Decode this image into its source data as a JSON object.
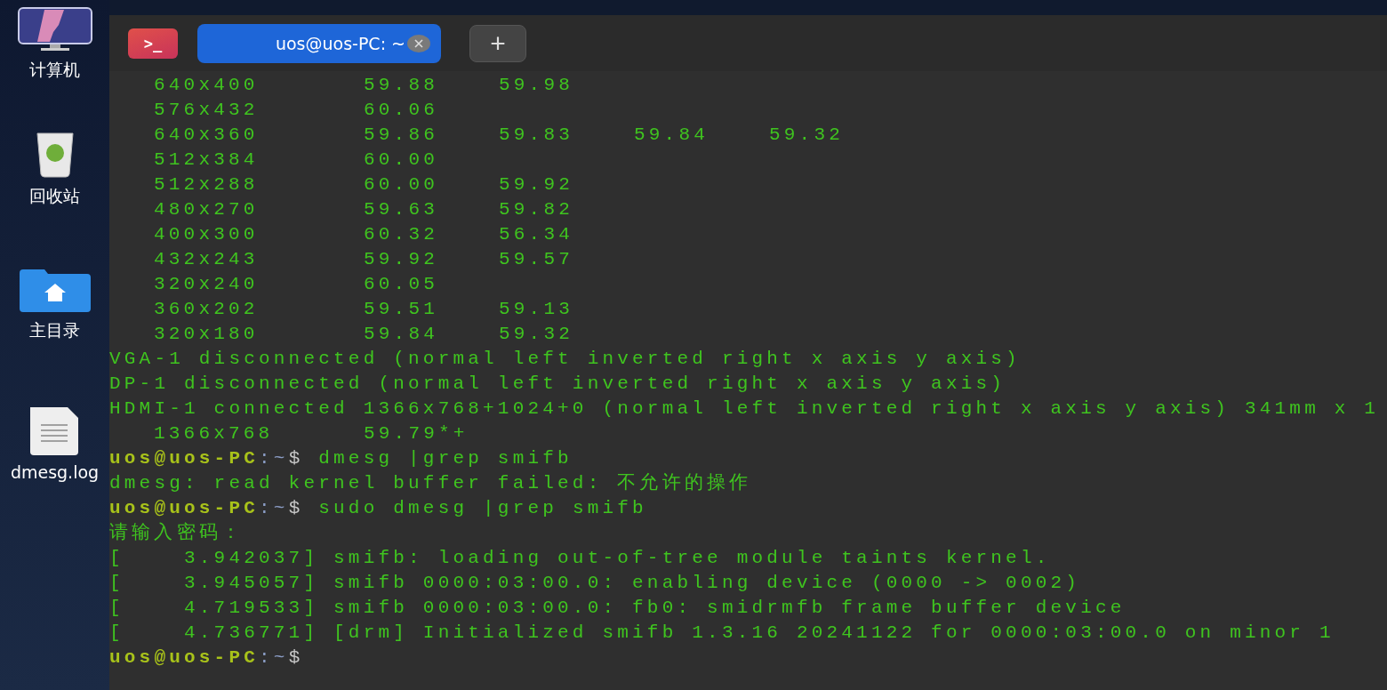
{
  "desktop": {
    "icons": [
      {
        "kind": "computer",
        "label": "计算机"
      },
      {
        "kind": "trash",
        "label": "回收站"
      },
      {
        "kind": "home",
        "label": "主目录"
      },
      {
        "kind": "file",
        "label": "dmesg.log"
      }
    ]
  },
  "terminal": {
    "app_glyph": ">_",
    "tabs": [
      {
        "title": "uos@uos-PC: ~",
        "selected": true
      }
    ],
    "new_tab": "+",
    "lines": [
      {
        "kind": "modes",
        "mode": "640x400",
        "rates": [
          "59.88",
          "59.98"
        ]
      },
      {
        "kind": "modes",
        "mode": "576x432",
        "rates": [
          "60.06"
        ]
      },
      {
        "kind": "modes",
        "mode": "640x360",
        "rates": [
          "59.86",
          "59.83",
          "59.84",
          "59.32"
        ]
      },
      {
        "kind": "modes",
        "mode": "512x384",
        "rates": [
          "60.00"
        ]
      },
      {
        "kind": "modes",
        "mode": "512x288",
        "rates": [
          "60.00",
          "59.92"
        ]
      },
      {
        "kind": "modes",
        "mode": "480x270",
        "rates": [
          "59.63",
          "59.82"
        ]
      },
      {
        "kind": "modes",
        "mode": "400x300",
        "rates": [
          "60.32",
          "56.34"
        ]
      },
      {
        "kind": "modes",
        "mode": "432x243",
        "rates": [
          "59.92",
          "59.57"
        ]
      },
      {
        "kind": "modes",
        "mode": "320x240",
        "rates": [
          "60.05"
        ]
      },
      {
        "kind": "modes",
        "mode": "360x202",
        "rates": [
          "59.51",
          "59.13"
        ]
      },
      {
        "kind": "modes",
        "mode": "320x180",
        "rates": [
          "59.84",
          "59.32"
        ]
      },
      {
        "kind": "output",
        "text": "VGA-1 disconnected (normal left inverted right x axis y axis)"
      },
      {
        "kind": "output",
        "text": "DP-1 disconnected (normal left inverted right x axis y axis)"
      },
      {
        "kind": "output",
        "text": "HDMI-1 connected 1366x768+1024+0 (normal left inverted right x axis y axis) 341mm x 1"
      },
      {
        "kind": "modes",
        "mode": "1366x768",
        "rates": [
          "59.79*+"
        ]
      },
      {
        "kind": "prompt",
        "user": "uos@uos-PC",
        "path": ":~",
        "sigil": "$",
        "command": "dmesg |grep smifb"
      },
      {
        "kind": "output",
        "text": "dmesg: read kernel buffer failed: 不允许的操作"
      },
      {
        "kind": "prompt",
        "user": "uos@uos-PC",
        "path": ":~",
        "sigil": "$",
        "command": "sudo dmesg |grep smifb"
      },
      {
        "kind": "output",
        "text": "请输入密码："
      },
      {
        "kind": "output",
        "text": "[    3.942037] smifb: loading out-of-tree module taints kernel."
      },
      {
        "kind": "output",
        "text": "[    3.945057] smifb 0000:03:00.0: enabling device (0000 -> 0002)"
      },
      {
        "kind": "output",
        "text": "[    4.719533] smifb 0000:03:00.0: fb0: smidrmfb frame buffer device"
      },
      {
        "kind": "output",
        "text": "[    4.736771] [drm] Initialized smifb 1.3.16 20241122 for 0000:03:00.0 on minor 1"
      },
      {
        "kind": "prompt",
        "user": "uos@uos-PC",
        "path": ":~",
        "sigil": "$"
      }
    ]
  }
}
